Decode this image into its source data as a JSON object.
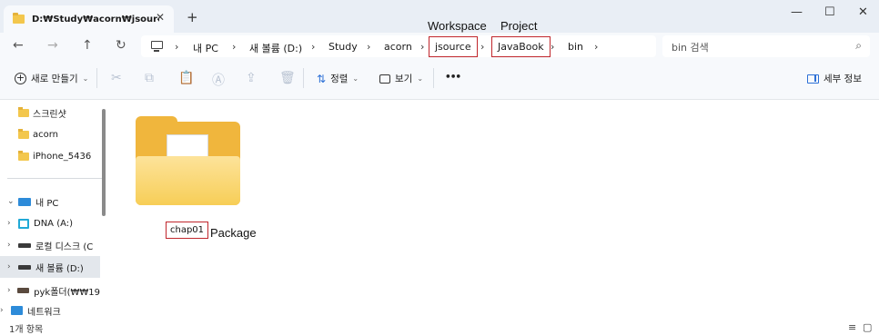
{
  "tab": {
    "title": "D:₩Study₩acorn₩jsource₩Ja",
    "close": "✕",
    "new_tab": "+"
  },
  "window": {
    "minimize": "—",
    "maximize": "☐",
    "close": "✕"
  },
  "annotations": {
    "workspace": "Workspace",
    "project": "Project",
    "package": "Package"
  },
  "nav": {
    "back": "←",
    "forward": "→",
    "up": "↑",
    "refresh": "↻"
  },
  "breadcrumb": {
    "sep": "›",
    "items": [
      "내 PC",
      "새 볼륨 (D:)",
      "Study",
      "acorn",
      "jsource",
      "JavaBook",
      "bin"
    ]
  },
  "search": {
    "placeholder": "bin 검색",
    "icon": "⌕"
  },
  "toolbar": {
    "new_label": "새로 만들기",
    "sort_label": "정렬",
    "view_label": "보기",
    "more": "•••",
    "details_label": "세부 정보",
    "caret": "⌄"
  },
  "sidebar": {
    "items": [
      {
        "label": "스크린샷"
      },
      {
        "label": "acorn"
      },
      {
        "label": "iPhone_5436"
      },
      {
        "label": "내 PC"
      },
      {
        "label": "DNA (A:)"
      },
      {
        "label": "로컬 디스크 (C"
      },
      {
        "label": "새 볼륨 (D:)"
      },
      {
        "label": "pyk폴더(₩₩19"
      },
      {
        "label": "네트워크"
      }
    ],
    "chev_right": "›",
    "chev_down": "⌄"
  },
  "content": {
    "folder_name": "chap01"
  },
  "status": {
    "item_count": "1개 항목",
    "list_view": "≡",
    "tile_view": "▢"
  },
  "colors": {
    "highlight_box": "#c0262c",
    "folder": "#f0b63d",
    "accent": "#2b6fd6"
  }
}
